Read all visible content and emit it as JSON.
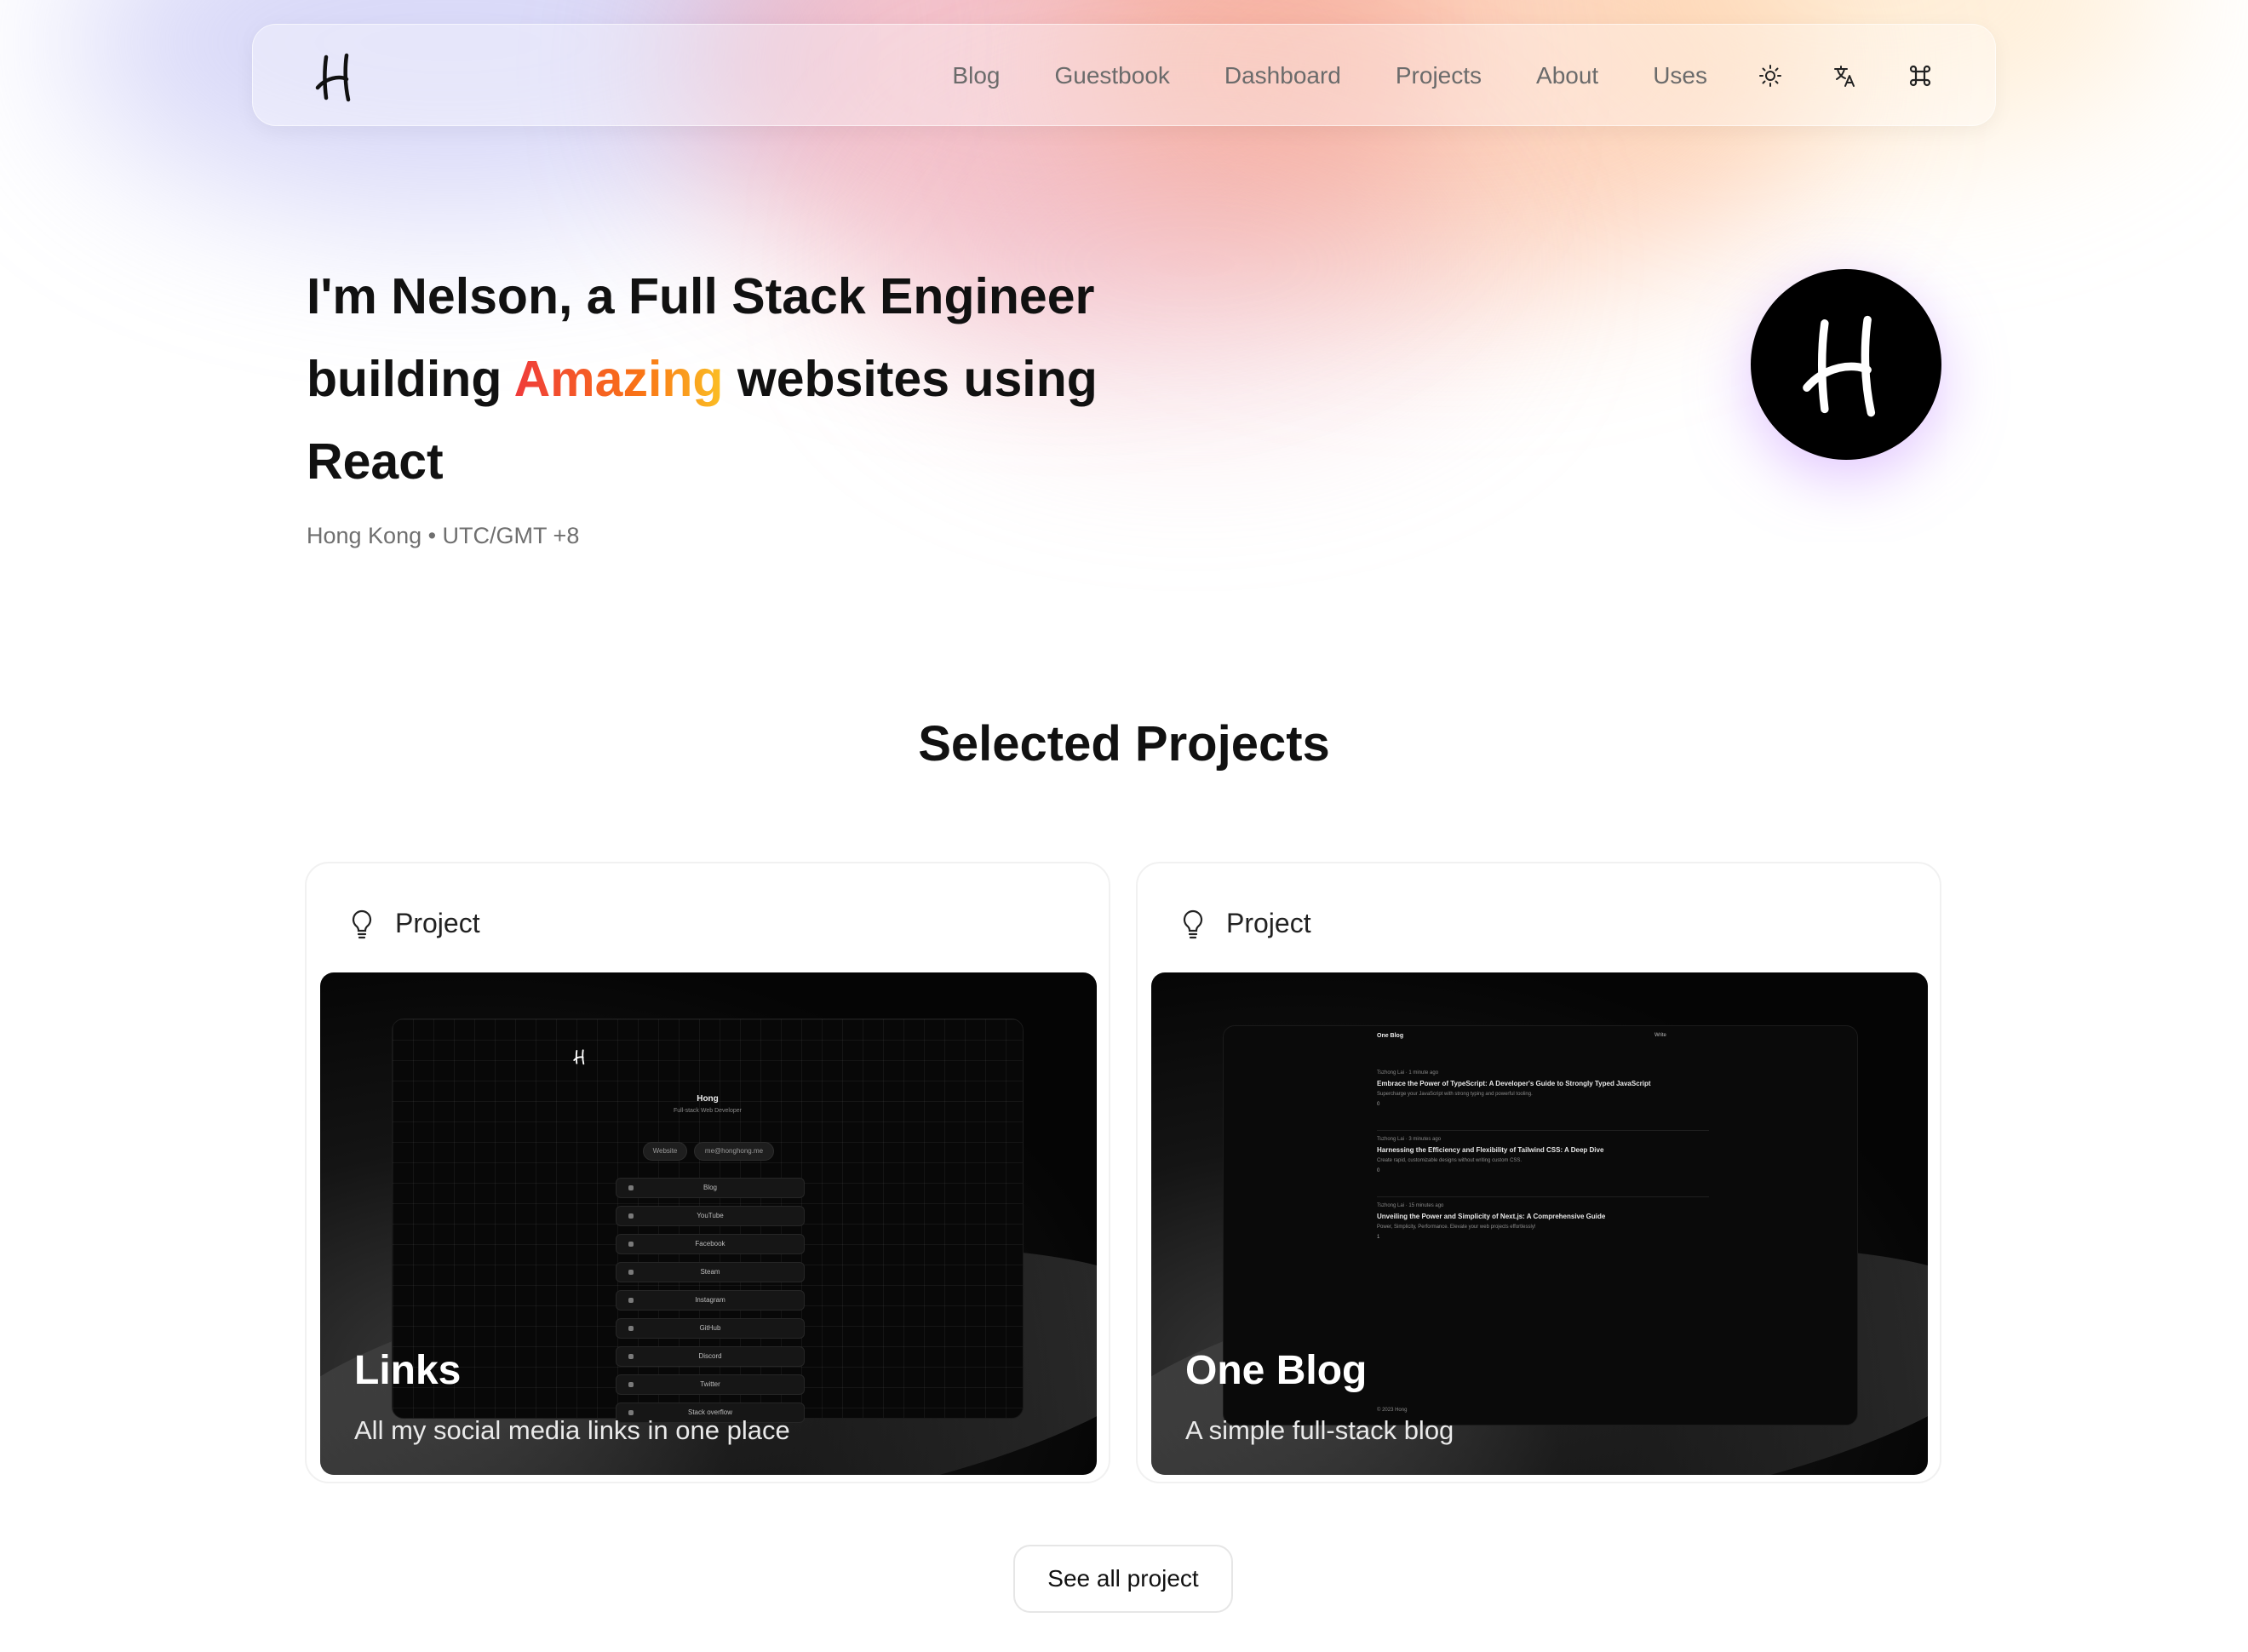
{
  "header": {
    "logo_icon": "h-signature-logo-icon",
    "nav": [
      {
        "label": "Blog"
      },
      {
        "label": "Guestbook"
      },
      {
        "label": "Dashboard"
      },
      {
        "label": "Projects"
      },
      {
        "label": "About"
      },
      {
        "label": "Uses"
      }
    ],
    "icons": [
      "sun-icon",
      "translate-icon",
      "command-icon"
    ]
  },
  "hero": {
    "title_part1": "I'm Nelson, a Full Stack Engineer building ",
    "title_accent": "Amazing",
    "title_part2": " websites using React",
    "location": "Hong Kong • UTC/GMT +8",
    "accent_colors": [
      "#ef3b3b",
      "#f97316",
      "#fbbf24"
    ]
  },
  "projects": {
    "section_title": "Selected Projects",
    "cards": [
      {
        "tag": "Project",
        "title": "Links",
        "description": "All my social media links in one place",
        "preview": {
          "name": "Hong",
          "subtitle": "Full-stack Web Developer",
          "pills": [
            "Website",
            "me@honghong.me"
          ],
          "links": [
            "Blog",
            "YouTube",
            "Facebook",
            "Steam",
            "Instagram",
            "GitHub",
            "Discord",
            "Twitter",
            "Stack overflow"
          ]
        }
      },
      {
        "tag": "Project",
        "title": "One Blog",
        "description": "A simple full-stack blog",
        "preview": {
          "brand": "One Blog",
          "write": "Write",
          "footer": "© 2023 Hong",
          "posts": [
            {
              "meta": "Tszhong Lai · 1 minute ago",
              "title": "Embrace the Power of TypeScript: A Developer's Guide to Strongly Typed JavaScript",
              "desc": "Supercharge your JavaScript with strong typing and powerful tooling.",
              "likes": "0"
            },
            {
              "meta": "Tszhong Lai · 3 minutes ago",
              "title": "Harnessing the Efficiency and Flexibility of Tailwind CSS: A Deep Dive",
              "desc": "Create rapid, customizable designs without writing custom CSS.",
              "likes": "0"
            },
            {
              "meta": "Tszhong Lai · 15 minutes ago",
              "title": "Unveiling the Power and Simplicity of Next.js: A Comprehensive Guide",
              "desc": "Power, Simplicity, Performance. Elevate your web projects effortlessly!",
              "likes": "1"
            }
          ]
        }
      }
    ],
    "see_all_label": "See all project"
  }
}
